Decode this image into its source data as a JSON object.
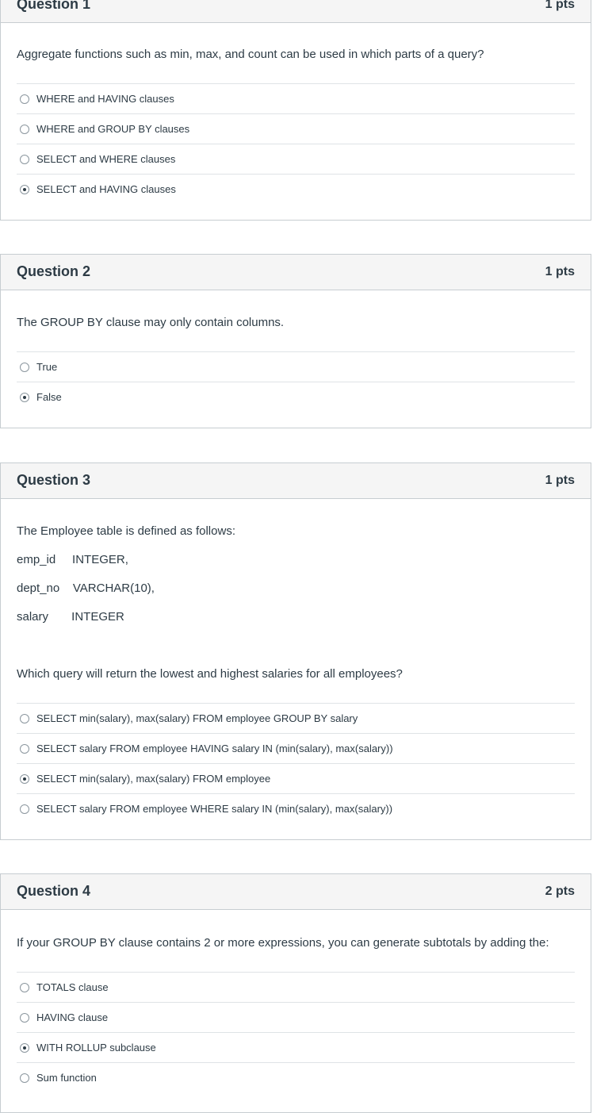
{
  "questions": [
    {
      "title": "Question 1",
      "points": "1 pts",
      "text": "Aggregate functions such as min, max, and count can be used in which parts of a query?",
      "answers": [
        {
          "label": "WHERE and HAVING clauses",
          "selected": false
        },
        {
          "label": "WHERE and GROUP BY clauses",
          "selected": false
        },
        {
          "label": "SELECT and WHERE clauses",
          "selected": false
        },
        {
          "label": "SELECT and HAVING clauses",
          "selected": true
        }
      ]
    },
    {
      "title": "Question 2",
      "points": "1 pts",
      "text": "The GROUP BY clause may only contain columns.",
      "answers": [
        {
          "label": "True",
          "selected": false
        },
        {
          "label": "False",
          "selected": true
        }
      ]
    },
    {
      "title": "Question 3",
      "points": "1 pts",
      "intro": "The Employee table is defined as follows:",
      "table_def": [
        "emp_id     INTEGER,",
        "dept_no    VARCHAR(10),",
        "salary       INTEGER"
      ],
      "text": "Which query will return the lowest and highest salaries for all employees?",
      "answers": [
        {
          "label": "SELECT min(salary), max(salary) FROM employee GROUP BY salary",
          "selected": false
        },
        {
          "label": "SELECT salary FROM employee HAVING salary IN (min(salary), max(salary))",
          "selected": false
        },
        {
          "label": "SELECT min(salary), max(salary) FROM employee",
          "selected": true
        },
        {
          "label": "SELECT salary FROM employee WHERE salary IN (min(salary), max(salary))",
          "selected": false
        }
      ]
    },
    {
      "title": "Question 4",
      "points": "2 pts",
      "text": "If your GROUP BY clause contains 2 or more expressions, you can generate subtotals by adding the:",
      "answers": [
        {
          "label": "TOTALS clause",
          "selected": false
        },
        {
          "label": "HAVING clause",
          "selected": false
        },
        {
          "label": "WITH ROLLUP subclause",
          "selected": true
        },
        {
          "label": "Sum function",
          "selected": false
        }
      ]
    }
  ]
}
